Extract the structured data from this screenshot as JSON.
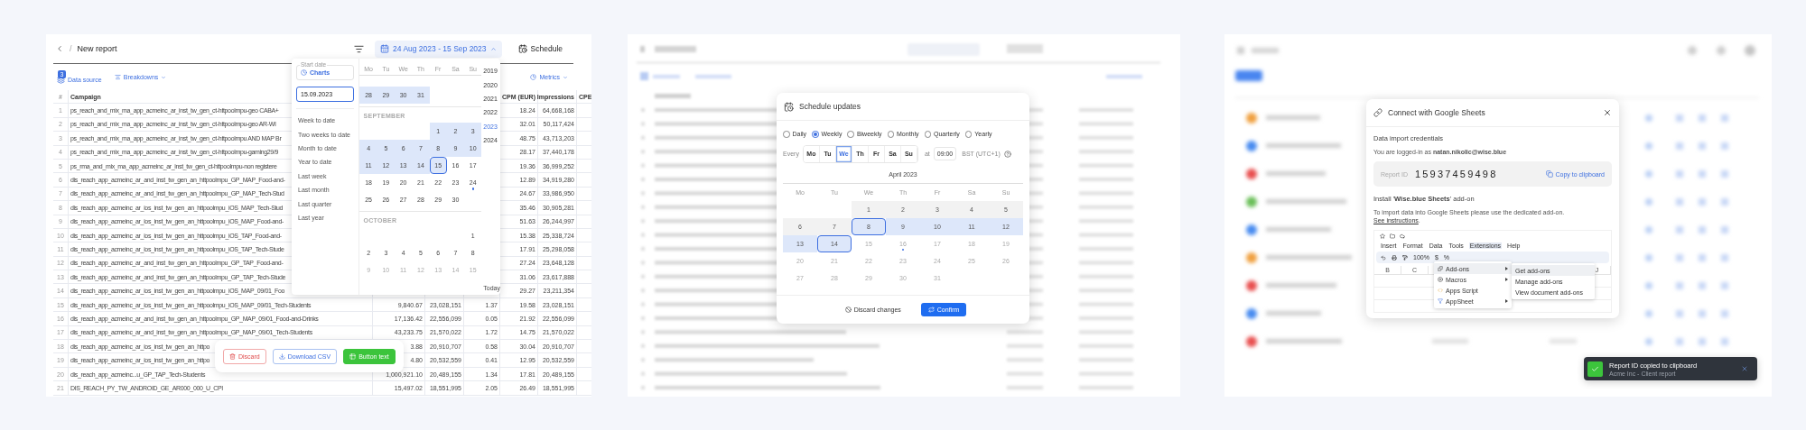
{
  "report": {
    "title": "New report",
    "separator": "/",
    "date_range": "24 Aug 2023 - 15 Sep 2023",
    "schedule": "Schedule",
    "toolbar": {
      "data_source": "Data source",
      "data_source_badge": "3",
      "breakdowns": "Breakdowns",
      "metrics": "Metrics"
    },
    "header": {
      "number": "#",
      "campaign": "Campaign",
      "cpm": "CPM (EUR)",
      "impressions": "Impressions",
      "column_8": "CPE"
    },
    "rows": [
      {
        "number": "1",
        "campaign": "ps_reach_and_mix_ma_app_acmeinc_ar_inst_tw_gen_ct-httpoolmpu-geo  CABA+",
        "cpm": "18.24",
        "impressions": "64,668,168"
      },
      {
        "number": "2",
        "campaign": "ps_reach_and_mix_ma_app_acmeinc_ar_inst_tw_gen_ct-httpoolmpu-geo  AR-WI",
        "cpm": "32.01",
        "impressions": "50,117,424"
      },
      {
        "number": "3",
        "campaign": "ps_reach_and_mix_ma_app_acmeinc_ar_inst_tw_gen_ct-httpoolmpu AND MAP Br",
        "cpm": "48.75",
        "impressions": "43,713,203"
      },
      {
        "number": "4",
        "campaign": "ps_reach_and_mix_ma_app_acmeinc_ar_inst_tw_gen_ct-httpoolmpu-gaming29/9",
        "cpm": "28.17",
        "impressions": "37,440,178"
      },
      {
        "number": "5",
        "campaign": "ps_rma_and_mix_ma_app_acmeinc_ar_inst_tw_gen_ct-httpoolmpu-non registere",
        "cpm": "19.36",
        "impressions": "36,999,252"
      },
      {
        "number": "6",
        "campaign": "dis_reach_app_acmeinc_ar_and_inst_tw_gen_an_httpoolmpu_GP_MAP_Food-and-",
        "cpm": "12.89",
        "impressions": "34,919,280"
      },
      {
        "number": "7",
        "campaign": "dis_reach_app_acmeinc_ar_and_inst_tw_gen_an_httpoolmpu_GP_MAP_Tech-Stud",
        "cpm": "24.67",
        "impressions": "33,986,950"
      },
      {
        "number": "8",
        "campaign": "dis_reach_app_acmeinc_ar_ios_inst_tw_gen_an_httpoolmpu_iOS_MAP_Tech-Stud",
        "cpm": "35.46",
        "impressions": "30,905,281"
      },
      {
        "number": "9",
        "campaign": "dis_reach_app_acmeinc_ar_ios_inst_tw_gen_an_httpoolmpu_iOS_MAP_Food-and-",
        "cpm": "51.63",
        "impressions": "26,244,997"
      },
      {
        "number": "10",
        "campaign": "dis_reach_app_acmeinc_ar_ios_inst_tw_gen_an_httpoolmpu_iOS_TAP_Food-and-",
        "cpm": "15.38",
        "impressions": "25,338,724"
      },
      {
        "number": "11",
        "campaign": "dis_reach_app_acmeinc_ar_ios_inst_tw_gen_an_httpoolmpu_iOS_TAP_Tech-Stude",
        "cpm": "17.91",
        "impressions": "25,298,058"
      },
      {
        "number": "12",
        "campaign": "dis_reach_app_acmeinc_ar_and_inst_tw_gen_an_httpoolmpu_GP_TAP_Food-and-",
        "cpm": "27.24",
        "impressions": "23,648,128"
      },
      {
        "number": "13",
        "campaign": "dis_reach_app_acmeinc_ar_and_inst_tw_gen_an_httpoolmpu_GP_TAP_Tech-Stude",
        "cpm": "31.06",
        "impressions": "23,617,888"
      },
      {
        "number": "14",
        "campaign": "dis_reach_app_acmeinc_ar_ios_inst_tw_gen_an_httpoolmpu_iOS_MAP_09/01_Foo",
        "cpm": "29.27",
        "impressions": "23,211,354"
      },
      {
        "number": "15",
        "campaign": "dis_reach_app_acmeinc_ar_ios_inst_tw_gen_an_httpoolmpu_iOS_MAP_09/01_Tech-Students",
        "column_3": "9,840.67",
        "column_4": "23,028,151",
        "column_5": "1.37",
        "cpm": "19.58",
        "impressions": "23,028,151"
      },
      {
        "number": "16",
        "campaign": "dis_reach_app_acmeinc_ar_and_inst_tw_gen_an_httpoolmpu_GP_MAP_09/01_Food-and-Drinks",
        "column_3": "17,136.42",
        "column_4": "22,556,099",
        "column_5": "0.05",
        "cpm": "21.92",
        "impressions": "22,556,099"
      },
      {
        "number": "17",
        "campaign": "dis_reach_app_acmeinc_ar_and_inst_tw_gen_an_httpoolmpu_GP_MAP_09/01_Tech-Students",
        "column_3": "43,233.75",
        "column_4": "21,570,022",
        "column_5": "1.72",
        "cpm": "14.75",
        "impressions": "21,570,022"
      },
      {
        "number": "18",
        "campaign": "dis_reach_app_acmeinc_ar_ios_inst_tw_gen_an_httpo",
        "column_3": "3.88",
        "column_4": "20,910,707",
        "column_5": "0.58",
        "cpm": "30.04",
        "impressions": "20,910,707"
      },
      {
        "number": "19",
        "campaign": "dis_reach_app_acmeinc_ar_ios_inst_tw_gen_an_httpo",
        "column_3": "4.80",
        "column_4": "20,532,559",
        "column_5": "0.41",
        "cpm": "12.95",
        "impressions": "20,532,559"
      },
      {
        "number": "20",
        "campaign": "dis_reach_app_acmeinc...u_GP_TAP_Tech-Students",
        "column_3": "1,000,921.10",
        "column_4": "20,489,155",
        "column_5": "1.34",
        "cpm": "17.81",
        "impressions": "20,489,155"
      },
      {
        "number": "21",
        "campaign": "DIS_REACH_PY_TW_ANDROID_GE_AR000_000_U_CPI",
        "column_3": "15,497.02",
        "column_4": "18,551,995",
        "column_5": "2.05",
        "cpm": "26.49",
        "impressions": "18,551,995"
      }
    ],
    "actions": [
      {
        "label": "Discard",
        "kind": "danger"
      },
      {
        "label": "Download CSV",
        "kind": "outline"
      },
      {
        "label": "Button text",
        "kind": "primary"
      }
    ]
  },
  "date_picker": {
    "start_label": "Start date",
    "start_value": "Charts",
    "end_value": "15.09.2023",
    "presets": [
      "Week to date",
      "Two weeks to date",
      "Month to date",
      "Year to date",
      "Last week",
      "Last month",
      "Last quarter",
      "Last year"
    ],
    "weekdays": [
      "Mo",
      "Tu",
      "We",
      "Th",
      "Fr",
      "Sa",
      "Su"
    ],
    "months": [
      {
        "weeks": [
          {
            "right_aligned": false,
            "days": [
              {
                "day": "28",
                "in_range": true,
                "selected": false,
                "today": false,
                "faded": false
              },
              {
                "day": "29",
                "in_range": true,
                "selected": false,
                "today": false,
                "faded": false
              },
              {
                "day": "30",
                "in_range": true,
                "selected": false,
                "today": false,
                "faded": false
              },
              {
                "day": "31",
                "in_range": true,
                "selected": false,
                "today": false,
                "faded": false
              }
            ]
          }
        ]
      },
      {
        "name": "SEPTEMBER",
        "weeks": [
          {
            "right_aligned": true,
            "days": [
              {
                "day": "1",
                "in_range": true,
                "selected": false,
                "today": false,
                "faded": false
              },
              {
                "day": "2",
                "in_range": true,
                "selected": false,
                "today": false,
                "faded": false
              },
              {
                "day": "3",
                "in_range": true,
                "selected": false,
                "today": false,
                "faded": false
              }
            ]
          },
          {
            "days": [
              {
                "day": "4",
                "in_range": true,
                "selected": false,
                "today": false,
                "faded": false
              },
              {
                "day": "5",
                "in_range": true,
                "selected": false,
                "today": false,
                "faded": false
              },
              {
                "day": "6",
                "in_range": true,
                "selected": false,
                "today": false,
                "faded": false
              },
              {
                "day": "7",
                "in_range": true,
                "selected": false,
                "today": false,
                "faded": false
              },
              {
                "day": "8",
                "in_range": true,
                "selected": false,
                "today": false,
                "faded": false
              },
              {
                "day": "9",
                "in_range": true,
                "selected": false,
                "today": false,
                "faded": false
              },
              {
                "day": "10",
                "in_range": true,
                "selected": false,
                "today": false,
                "faded": false
              }
            ]
          },
          {
            "days": [
              {
                "day": "11",
                "in_range": true,
                "selected": false,
                "today": false,
                "faded": false
              },
              {
                "day": "12",
                "in_range": true,
                "selected": false,
                "today": false,
                "faded": false
              },
              {
                "day": "13",
                "in_range": true,
                "selected": false,
                "today": false,
                "faded": false
              },
              {
                "day": "14",
                "in_range": true,
                "selected": false,
                "today": false,
                "faded": false
              },
              {
                "day": "15",
                "in_range": true,
                "selected": true,
                "today": false,
                "faded": false
              },
              {
                "day": "16",
                "in_range": false,
                "selected": false,
                "today": false,
                "faded": false
              },
              {
                "day": "17",
                "in_range": false,
                "selected": false,
                "today": false,
                "faded": false
              }
            ]
          },
          {
            "days": [
              {
                "day": "18",
                "in_range": false,
                "selected": false,
                "today": false,
                "faded": false
              },
              {
                "day": "19",
                "in_range": false,
                "selected": false,
                "today": false,
                "faded": false
              },
              {
                "day": "20",
                "in_range": false,
                "selected": false,
                "today": false,
                "faded": false
              },
              {
                "day": "21",
                "in_range": false,
                "selected": false,
                "today": false,
                "faded": false
              },
              {
                "day": "22",
                "in_range": false,
                "selected": false,
                "today": false,
                "faded": false
              },
              {
                "day": "23",
                "in_range": false,
                "selected": false,
                "today": false,
                "faded": false
              },
              {
                "day": "24",
                "in_range": false,
                "selected": false,
                "today": true,
                "faded": false
              }
            ]
          },
          {
            "right_aligned": false,
            "days": [
              {
                "day": "25",
                "in_range": false,
                "selected": false,
                "today": false,
                "faded": false
              },
              {
                "day": "26",
                "in_range": false,
                "selected": false,
                "today": false,
                "faded": false
              },
              {
                "day": "27",
                "in_range": false,
                "selected": false,
                "today": false,
                "faded": false
              },
              {
                "day": "28",
                "in_range": false,
                "selected": false,
                "today": false,
                "faded": false
              },
              {
                "day": "29",
                "in_range": false,
                "selected": false,
                "today": false,
                "faded": false
              },
              {
                "day": "30",
                "in_range": false,
                "selected": false,
                "today": false,
                "faded": false
              }
            ]
          }
        ]
      },
      {
        "name": "OCTOBER",
        "weeks": [
          {
            "right_aligned": true,
            "days": [
              {
                "day": "1",
                "in_range": false,
                "selected": false,
                "today": false,
                "faded": false
              }
            ]
          },
          {
            "days": [
              {
                "day": "2",
                "in_range": false,
                "selected": false,
                "today": false,
                "faded": false
              },
              {
                "day": "3",
                "in_range": false,
                "selected": false,
                "today": false,
                "faded": false
              },
              {
                "day": "4",
                "in_range": false,
                "selected": false,
                "today": false,
                "faded": false
              },
              {
                "day": "5",
                "in_range": false,
                "selected": false,
                "today": false,
                "faded": false
              },
              {
                "day": "6",
                "in_range": false,
                "selected": false,
                "today": false,
                "faded": false
              },
              {
                "day": "7",
                "in_range": false,
                "selected": false,
                "today": false,
                "faded": false
              },
              {
                "day": "8",
                "in_range": false,
                "selected": false,
                "today": false,
                "faded": false
              }
            ]
          },
          {
            "days": [
              {
                "day": "9",
                "in_range": false,
                "selected": false,
                "today": false,
                "faded": true
              },
              {
                "day": "10",
                "in_range": false,
                "selected": false,
                "today": false,
                "faded": true
              },
              {
                "day": "11",
                "in_range": false,
                "selected": false,
                "today": false,
                "faded": true
              },
              {
                "day": "12",
                "in_range": false,
                "selected": false,
                "today": false,
                "faded": true
              },
              {
                "day": "13",
                "in_range": false,
                "selected": false,
                "today": false,
                "faded": true
              },
              {
                "day": "14",
                "in_range": false,
                "selected": false,
                "today": false,
                "faded": true
              },
              {
                "day": "15",
                "in_range": false,
                "selected": false,
                "today": false,
                "faded": true
              }
            ]
          }
        ]
      }
    ],
    "years": [
      {
        "label": "2019",
        "selected": false
      },
      {
        "label": "2020",
        "selected": false
      },
      {
        "label": "2021",
        "selected": false
      },
      {
        "label": "2022",
        "selected": false
      },
      {
        "label": "2023",
        "selected": true
      },
      {
        "label": "2024",
        "selected": false
      }
    ],
    "today": "Today"
  },
  "schedule": {
    "title": "Schedule updates",
    "frequencies": [
      {
        "label": "Daily",
        "selected": false
      },
      {
        "label": "Weekly",
        "selected": true
      },
      {
        "label": "Biweekly",
        "selected": false
      },
      {
        "label": "Monthly",
        "selected": false
      },
      {
        "label": "Quarterly",
        "selected": false
      },
      {
        "label": "Yearly",
        "selected": false
      }
    ],
    "every_label": "Every",
    "days": [
      {
        "label": "Mo",
        "selected": false
      },
      {
        "label": "Tu",
        "selected": false
      },
      {
        "label": "We",
        "selected": true
      },
      {
        "label": "Th",
        "selected": false
      },
      {
        "label": "Fr",
        "selected": false
      },
      {
        "label": "Sa",
        "selected": false
      },
      {
        "label": "Su",
        "selected": false
      }
    ],
    "at_label": "at",
    "time": "09:00",
    "timezone": "BST (UTC+1)",
    "month": "April 2023",
    "weekdays": [
      "Mo",
      "Tu",
      "We",
      "Th",
      "Fr",
      "Sa",
      "Su"
    ],
    "weeks": [
      {
        "right_aligned": true,
        "days": [
          {
            "day": "1",
            "past": true,
            "in_range": false,
            "selected": false,
            "marked": false
          },
          {
            "day": "2",
            "past": true,
            "in_range": false,
            "selected": false,
            "marked": false
          },
          {
            "day": "3",
            "past": true,
            "in_range": false,
            "selected": false,
            "marked": false
          },
          {
            "day": "4",
            "past": true,
            "in_range": false,
            "selected": false,
            "marked": false
          },
          {
            "day": "5",
            "past": true,
            "in_range": false,
            "selected": false,
            "marked": false
          }
        ]
      },
      {
        "days": [
          {
            "day": "6",
            "past": true,
            "in_range": false,
            "selected": false,
            "marked": false
          },
          {
            "day": "7",
            "past": true,
            "in_range": false,
            "selected": false,
            "marked": false
          },
          {
            "day": "8",
            "past": false,
            "in_range": true,
            "selected": true,
            "marked": false
          },
          {
            "day": "9",
            "past": false,
            "in_range": true,
            "selected": false,
            "marked": false
          },
          {
            "day": "10",
            "past": false,
            "in_range": true,
            "selected": false,
            "marked": false
          },
          {
            "day": "11",
            "past": false,
            "in_range": true,
            "selected": false,
            "marked": false
          },
          {
            "day": "12",
            "past": false,
            "in_range": true,
            "selected": false,
            "marked": false
          }
        ]
      },
      {
        "days": [
          {
            "day": "13",
            "past": false,
            "in_range": true,
            "selected": false,
            "marked": false
          },
          {
            "day": "14",
            "past": false,
            "in_range": true,
            "selected": true,
            "marked": false
          },
          {
            "day": "15",
            "past": false,
            "in_range": false,
            "selected": false,
            "marked": false
          },
          {
            "day": "16",
            "past": false,
            "in_range": false,
            "selected": false,
            "marked": true
          },
          {
            "day": "17",
            "past": false,
            "in_range": false,
            "selected": false,
            "marked": false
          },
          {
            "day": "18",
            "past": false,
            "in_range": false,
            "selected": false,
            "marked": false
          },
          {
            "day": "19",
            "past": false,
            "in_range": false,
            "selected": false,
            "marked": false
          }
        ]
      },
      {
        "days": [
          {
            "day": "20",
            "past": false,
            "in_range": false,
            "selected": false,
            "marked": false
          },
          {
            "day": "21",
            "past": false,
            "in_range": false,
            "selected": false,
            "marked": false
          },
          {
            "day": "22",
            "past": false,
            "in_range": false,
            "selected": false,
            "marked": false
          },
          {
            "day": "23",
            "past": false,
            "in_range": false,
            "selected": false,
            "marked": false
          },
          {
            "day": "24",
            "past": false,
            "in_range": false,
            "selected": false,
            "marked": false
          },
          {
            "day": "25",
            "past": false,
            "in_range": false,
            "selected": false,
            "marked": false
          },
          {
            "day": "26",
            "past": false,
            "in_range": false,
            "selected": false,
            "marked": false
          }
        ]
      },
      {
        "right_aligned": false,
        "days": [
          {
            "day": "27",
            "past": false,
            "in_range": false,
            "selected": false,
            "marked": false
          },
          {
            "day": "28",
            "past": false,
            "in_range": false,
            "selected": false,
            "marked": false
          },
          {
            "day": "29",
            "past": false,
            "in_range": false,
            "selected": false,
            "marked": false
          },
          {
            "day": "30",
            "past": false,
            "in_range": false,
            "selected": false,
            "marked": false
          },
          {
            "day": "31",
            "past": false,
            "in_range": false,
            "selected": false,
            "marked": false
          }
        ]
      }
    ],
    "discard": "Discard changes",
    "confirm": "Confirm"
  },
  "sheets": {
    "title": "Connect with Google Sheets",
    "section_title": "Data import credentials",
    "logged_in": "You are logged-in as **natan.nikolic@wise.blue**",
    "report_id_label": "Report ID",
    "report_id": "15937459498",
    "copy": "Copy to clipboard",
    "install_title": "Install '**Wise.blue Sheets**' add-on",
    "instructions": "To import data into Google Sheets please use the dedicated add-on.",
    "instructions_link": "See instructions",
    "instructions_end": ".",
    "preview": {
      "menu": [
        {
          "label": "Insert",
          "selected": false
        },
        {
          "label": "Format",
          "selected": false
        },
        {
          "label": "Data",
          "selected": false
        },
        {
          "label": "Tools",
          "selected": false
        },
        {
          "label": "Extensions",
          "selected": true
        },
        {
          "label": "Help",
          "selected": false
        }
      ],
      "zoom": "100%",
      "currency": "$",
      "percent": "%",
      "menu_items": [
        {
          "label": "Add-ons",
          "submenu": true,
          "selected": true
        },
        {
          "label": "Macros",
          "submenu": true,
          "selected": false
        },
        {
          "label": "Apps Script",
          "submenu": false,
          "selected": false
        },
        {
          "label": "AppSheet",
          "submenu": true,
          "selected": false
        }
      ],
      "submenu": [
        {
          "label": "Get add-ons",
          "selected": true
        },
        {
          "label": "Manage add-ons",
          "selected": false
        },
        {
          "label": "View document add-ons",
          "selected": false
        }
      ],
      "columns": [
        "B",
        "C",
        "J"
      ]
    }
  },
  "toast": {
    "title": "Report ID copied to clipboard",
    "subtitle": "Acme Inc - Client report"
  }
}
